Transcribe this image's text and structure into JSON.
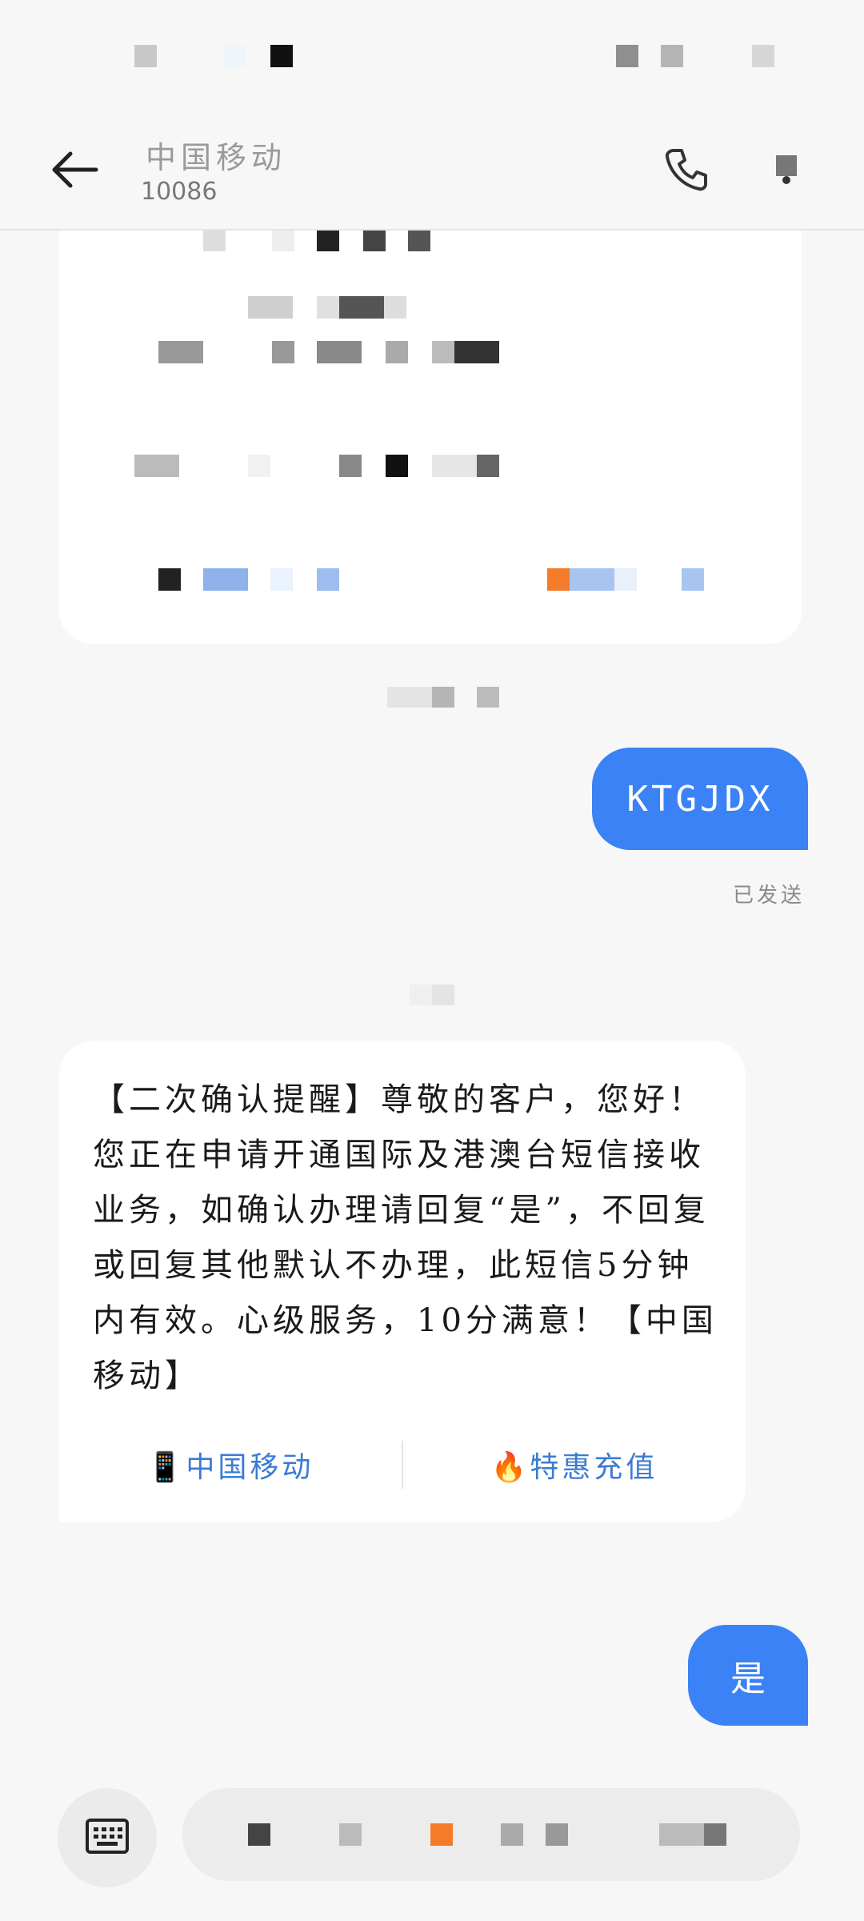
{
  "header": {
    "title": "中国移动",
    "subtitle": "10086",
    "icons": {
      "back": "back-arrow-icon",
      "call": "phone-icon",
      "more": "more-icon"
    }
  },
  "messages": {
    "sent_1": {
      "text": "KTGJDX",
      "status": "已发送"
    },
    "received_1": {
      "text": "【二次确认提醒】尊敬的客户，您好！您正在申请开通国际及港澳台短信接收业务，如确认办理请回复“是”，不回复或回复其他默认不办理，此短信5分钟内有效。心级服务，10分满意！【中国移动】",
      "links": [
        {
          "emoji": "📱",
          "label": "中国移动"
        },
        {
          "emoji": "🔥",
          "label": "特惠充值"
        }
      ]
    },
    "sent_2": {
      "text": "是"
    }
  },
  "input": {
    "keyboard_icon": "keyboard-icon"
  },
  "colors": {
    "accent": "#3b82f6",
    "link": "#3a7bd5",
    "background": "#f7f7f7"
  }
}
